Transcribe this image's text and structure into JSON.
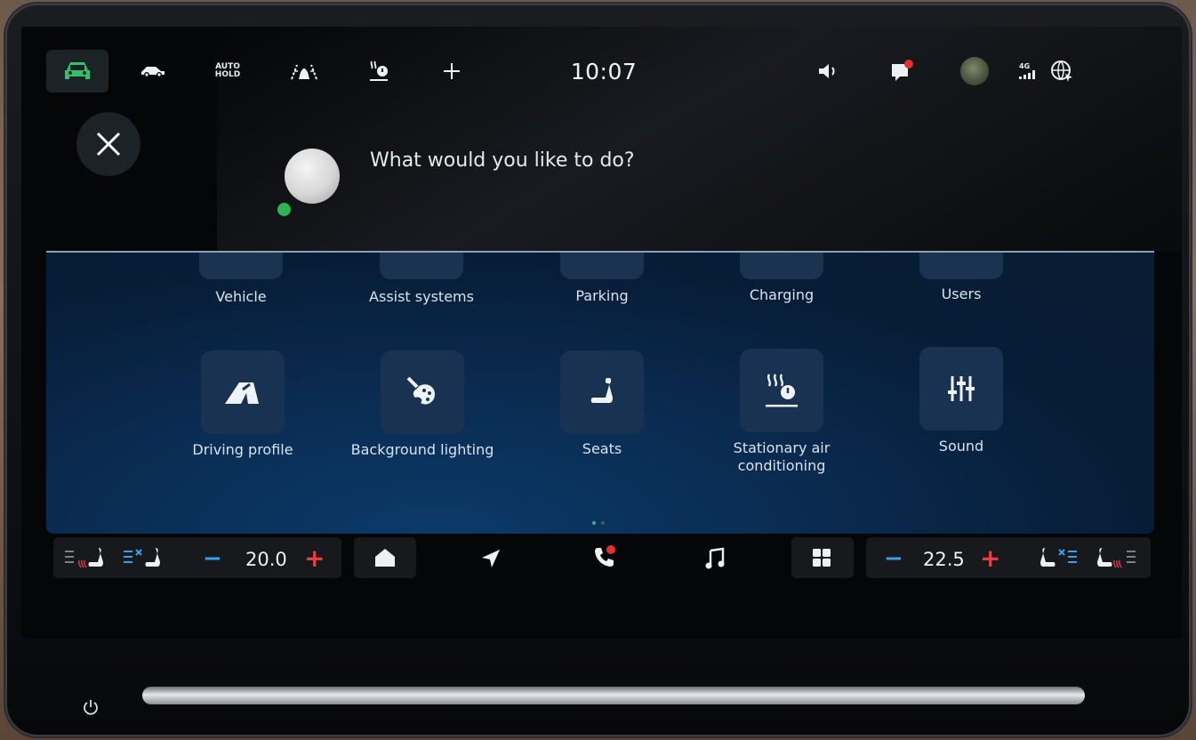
{
  "status_bar": {
    "clock": "10:07",
    "auto_hold_line1": "AUTO",
    "auto_hold_line2": "HOLD",
    "network_label": "4G",
    "icons": [
      "car-status-icon",
      "car-side-icon",
      "auto-hold-icon",
      "assist-icon",
      "stationary-heating-icon",
      "add-icon",
      "volume-icon",
      "notification-icon",
      "avatar",
      "signal-icon",
      "globe-icon"
    ]
  },
  "assistant": {
    "prompt": "What would you like to do?"
  },
  "apps": {
    "row1": [
      {
        "label": "Vehicle"
      },
      {
        "label": "Assist systems"
      },
      {
        "label": "Parking"
      },
      {
        "label": "Charging"
      },
      {
        "label": "Users"
      }
    ],
    "row2": [
      {
        "label": "Driving profile",
        "icon": "road-icon"
      },
      {
        "label": "Background lighting",
        "icon": "palette-icon"
      },
      {
        "label": "Seats",
        "icon": "seat-icon"
      },
      {
        "label": "Stationary air conditioning",
        "label_line1": "Stationary air",
        "label_line2": "conditioning",
        "icon": "stationary-ac-icon"
      },
      {
        "label": "Sound",
        "icon": "equalizer-icon"
      }
    ]
  },
  "climate": {
    "left_temp": "20.0",
    "right_temp": "22.5",
    "minus": "−",
    "plus": "+"
  },
  "colors": {
    "accent_green": "#2fb15a",
    "minus_blue": "#3aa0ea",
    "plus_red": "#e54040",
    "notification_red": "#e53030"
  }
}
